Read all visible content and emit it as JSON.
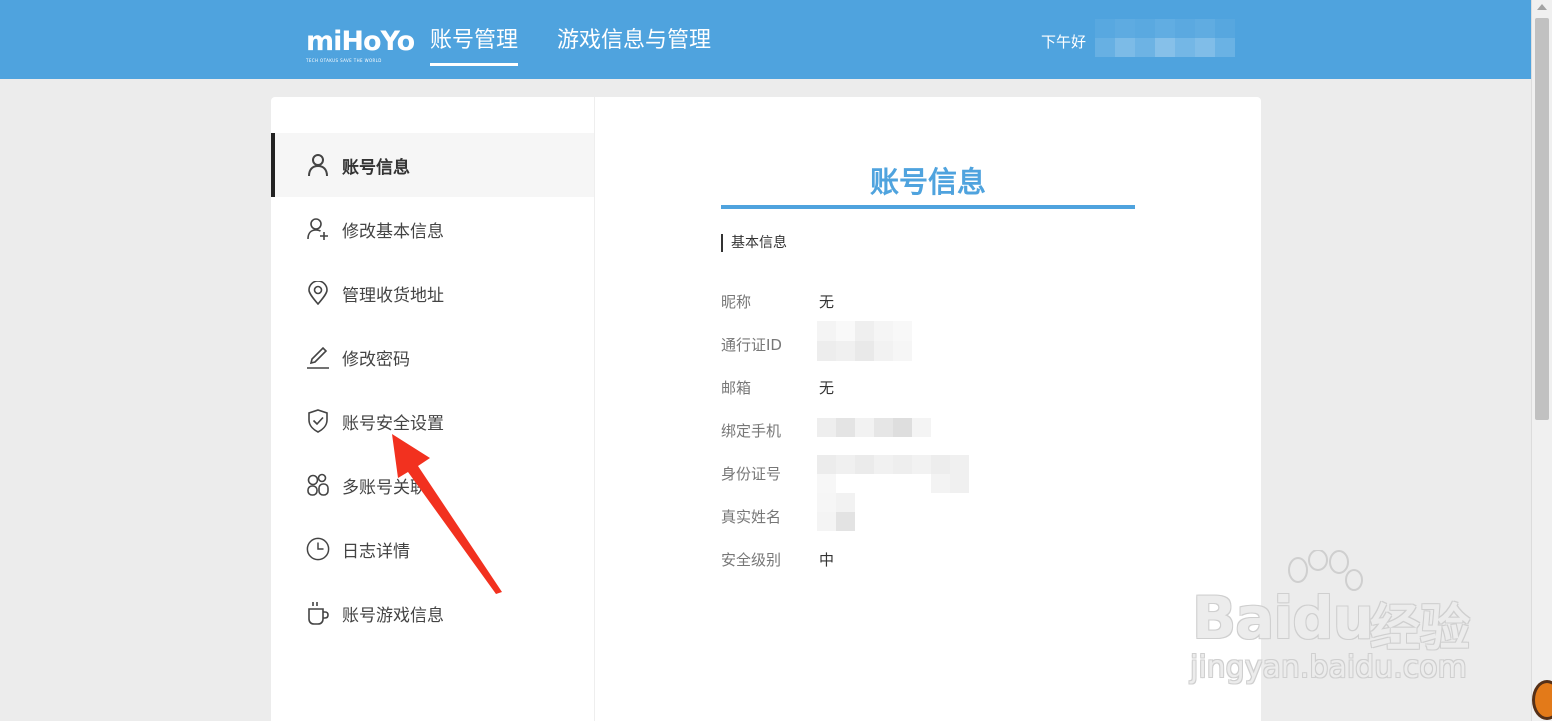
{
  "header": {
    "logo_text": "miHoYo",
    "logo_tagline": "TECH OTAKUS SAVE THE WORLD",
    "tabs": [
      {
        "label": "账号管理",
        "active": true
      },
      {
        "label": "游戏信息与管理",
        "active": false
      }
    ],
    "greeting": "下午好",
    "brand_color": "#4fa3de"
  },
  "sidebar": {
    "items": [
      {
        "label": "账号信息",
        "icon": "user-icon",
        "active": true
      },
      {
        "label": "修改基本信息",
        "icon": "user-plus-icon",
        "active": false
      },
      {
        "label": "管理收货地址",
        "icon": "location-pin-icon",
        "active": false
      },
      {
        "label": "修改密码",
        "icon": "pencil-icon",
        "active": false
      },
      {
        "label": "账号安全设置",
        "icon": "shield-check-icon",
        "active": false
      },
      {
        "label": "多账号关联",
        "icon": "multi-user-icon",
        "active": false
      },
      {
        "label": "日志详情",
        "icon": "clock-icon",
        "active": false
      },
      {
        "label": "账号游戏信息",
        "icon": "cup-icon",
        "active": false
      }
    ]
  },
  "main": {
    "title": "账号信息",
    "section": "基本信息",
    "fields": [
      {
        "label": "昵称",
        "value": "无"
      },
      {
        "label": "通行证ID",
        "value": ""
      },
      {
        "label": "邮箱",
        "value": "无"
      },
      {
        "label": "绑定手机",
        "value": ""
      },
      {
        "label": "身份证号",
        "value": ""
      },
      {
        "label": "真实姓名",
        "value": ""
      },
      {
        "label": "安全级别",
        "value": "中"
      }
    ]
  },
  "watermark": {
    "brand": "Baidu",
    "product": "经验",
    "url": "jingyan.baidu.com"
  },
  "annotation": {
    "arrow_color": "#f2311f"
  }
}
